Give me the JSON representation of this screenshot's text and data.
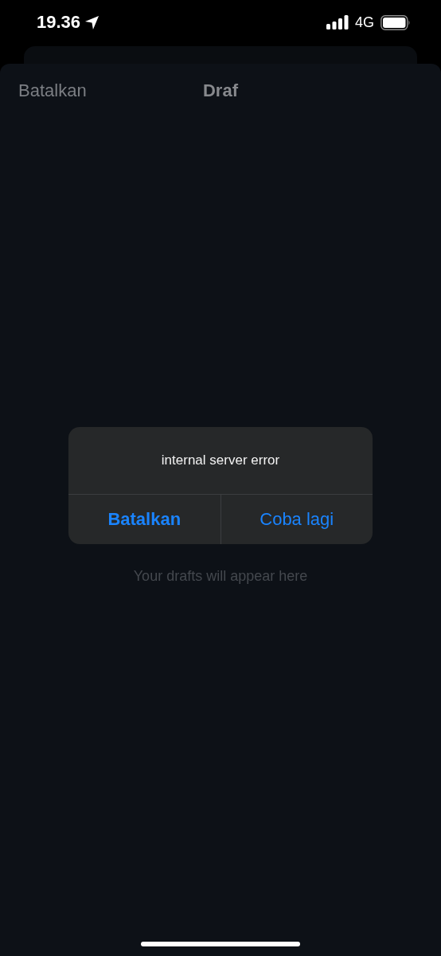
{
  "status_bar": {
    "time": "19.36",
    "network": "4G"
  },
  "nav": {
    "cancel": "Batalkan",
    "title": "Draf"
  },
  "empty_state": {
    "message": "Your drafts will appear here"
  },
  "alert": {
    "message": "internal server error",
    "buttons": [
      {
        "label": "Batalkan",
        "kind": "preferred"
      },
      {
        "label": "Coba lagi",
        "kind": "normal"
      }
    ]
  }
}
